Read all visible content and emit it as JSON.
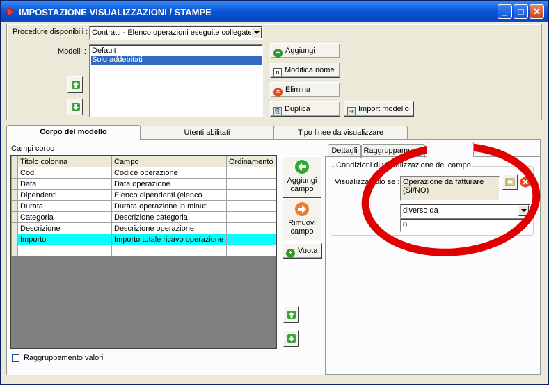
{
  "window": {
    "title": "IMPOSTAZIONE VISUALIZZAZIONI / STAMPE"
  },
  "procedure": {
    "label": "Procedure disponibili :",
    "selected": "Contratti - Elenco operazioni eseguite collegate"
  },
  "modelli": {
    "label": "Modelli :",
    "items": [
      "Default",
      "Solo addebitati"
    ],
    "selected_index": 1
  },
  "buttons": {
    "aggiungi": "Aggiungi",
    "modifica_nome": "Modifica nome",
    "elimina": "Elimina",
    "duplica": "Duplica",
    "import_modello": "Import modello"
  },
  "tabs": [
    "Corpo del modello",
    "Utenti abilitati",
    "Tipo linee da visualizzare"
  ],
  "campi_corpo": {
    "label": "Campi corpo",
    "columns": [
      "Titolo colonna",
      "Campo",
      "Ordinamento"
    ],
    "rows": [
      {
        "titolo": "Cod.",
        "campo": "Codice operazione",
        "ordinamento": ""
      },
      {
        "titolo": "Data",
        "campo": "Data operazione",
        "ordinamento": ""
      },
      {
        "titolo": "Dipendenti",
        "campo": "Elenco dipendenti (elenco",
        "ordinamento": ""
      },
      {
        "titolo": "Durata",
        "campo": "Durata operazione in minuti",
        "ordinamento": ""
      },
      {
        "titolo": "Categoria",
        "campo": "Descrizione categoria",
        "ordinamento": ""
      },
      {
        "titolo": "Descrizione",
        "campo": "Descrizione operazione",
        "ordinamento": ""
      },
      {
        "titolo": "Importo",
        "campo": "Importo totale ricavo operazione",
        "ordinamento": ""
      }
    ],
    "selected_row": 6
  },
  "side_buttons": {
    "aggiungi_campo": [
      "Aggiungi",
      "campo"
    ],
    "rimuovi_campo": [
      "Rimuovi",
      "campo"
    ],
    "vuota": "Vuota"
  },
  "raggruppamento_valori": {
    "label": "Raggruppamento valori",
    "checked": false
  },
  "subtabs": [
    "Dettagli",
    "Raggruppamento",
    ""
  ],
  "condizioni": {
    "group_label": "Condizioni di visualizzazione del campo",
    "visualizza_label": "Visualizza solo se :",
    "field_value": "Operazione da fatturare (SI/NO)",
    "operator": "diverso da",
    "value": "0"
  },
  "colors": {
    "title_blue": "#0a58d8",
    "selection": "#316ac5",
    "highlight_row": "#00ffff",
    "annotation": "#e00000"
  }
}
